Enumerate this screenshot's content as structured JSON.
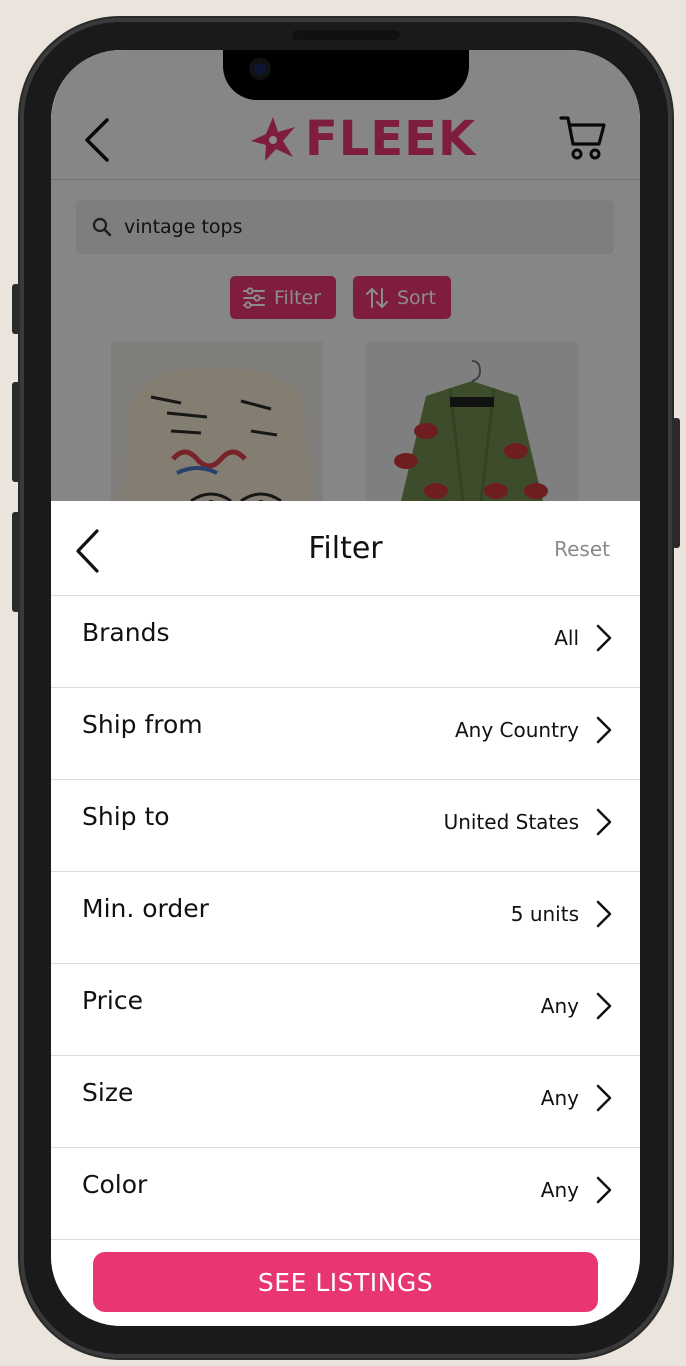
{
  "app": {
    "brand": "FLEEK",
    "search": {
      "value": "vintage tops"
    },
    "filter_chip": "Filter",
    "sort_chip": "Sort"
  },
  "filter_sheet": {
    "title": "Filter",
    "reset_label": "Reset",
    "rows": [
      {
        "label": "Brands",
        "value": "All"
      },
      {
        "label": "Ship from",
        "value": "Any Country"
      },
      {
        "label": "Ship to",
        "value": "United States"
      },
      {
        "label": "Min. order",
        "value": "5 units"
      },
      {
        "label": "Price",
        "value": "Any"
      },
      {
        "label": "Size",
        "value": "Any"
      },
      {
        "label": "Color",
        "value": "Any"
      }
    ],
    "cta_label": "SEE LISTINGS"
  },
  "colors": {
    "accent": "#e83573",
    "background": "#ebe4dd",
    "muted_text": "#8a8a8a"
  },
  "icons": [
    "back-arrow-icon",
    "star-logo-icon",
    "cart-icon",
    "search-icon",
    "sliders-icon",
    "sort-arrows-icon",
    "chevron-right-icon"
  ]
}
